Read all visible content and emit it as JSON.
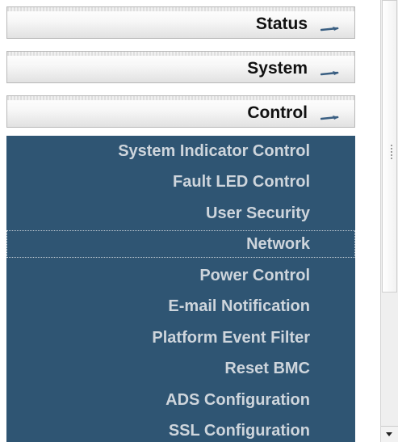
{
  "sections": [
    {
      "label": "Status",
      "icon": "collapse-arrow-icon"
    },
    {
      "label": "System",
      "icon": "collapse-arrow-icon"
    },
    {
      "label": "Control",
      "icon": "collapse-arrow-icon"
    }
  ],
  "control_menu": {
    "items": [
      {
        "label": "System Indicator Control"
      },
      {
        "label": "Fault LED Control"
      },
      {
        "label": "User Security"
      },
      {
        "label": "Network",
        "focused": true
      },
      {
        "label": "Power Control"
      },
      {
        "label": "E-mail Notification"
      },
      {
        "label": "Platform Event Filter"
      },
      {
        "label": "Reset BMC"
      },
      {
        "label": "ADS Configuration"
      },
      {
        "label": "SSL Configuration"
      }
    ]
  },
  "colors": {
    "submenu_background": "#2f5573",
    "submenu_text": "#ced5dc",
    "header_text": "#111111"
  },
  "scrollbar": {
    "down_icon": "triangle-down-icon"
  }
}
